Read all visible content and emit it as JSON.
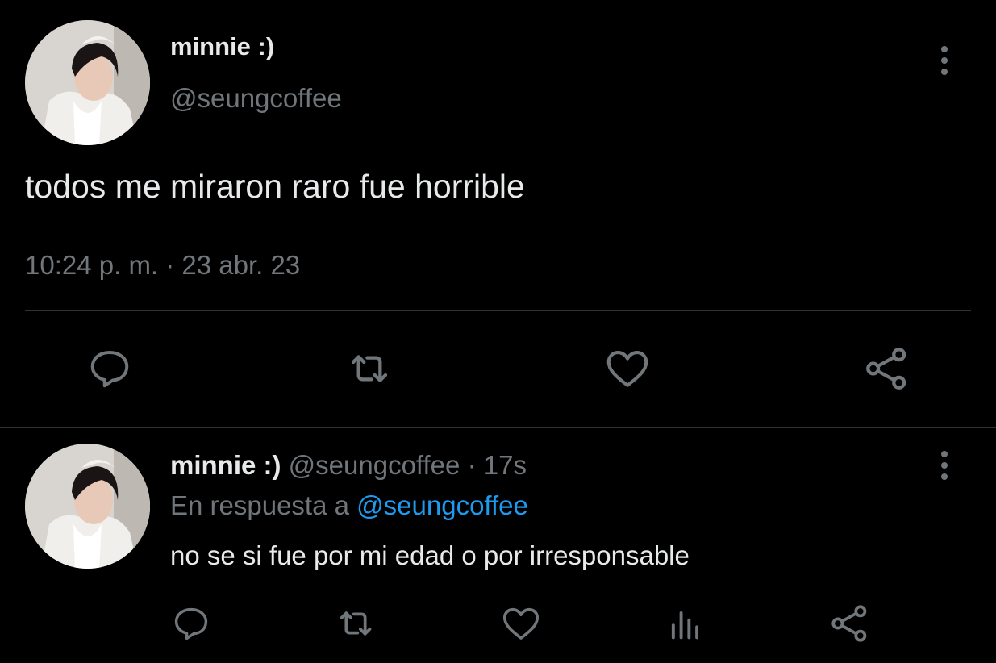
{
  "main_tweet": {
    "author_name": "minnie :)",
    "author_handle": "@seungcoffee",
    "text": "todos me miraron raro fue horrible",
    "timestamp": "10:24 p. m. · 23 abr. 23",
    "actions": [
      "reply-icon",
      "retweet-icon",
      "like-icon",
      "share-icon"
    ]
  },
  "reply_tweet": {
    "author_name": "minnie :)",
    "author_handle": "@seungcoffee",
    "separator": "·",
    "time_ago": "17s",
    "replying_to_label": "En respuesta a",
    "replying_to_handle": "@seungcoffee",
    "text": "no se si fue por mi edad o por irresponsable",
    "actions": [
      "reply-icon",
      "retweet-icon",
      "like-icon",
      "views-icon",
      "share-icon"
    ]
  },
  "colors": {
    "background": "#000000",
    "primary_text": "#e7e9ea",
    "secondary_text": "#71767b",
    "link": "#1d9bf0",
    "divider": "#2f3336"
  }
}
